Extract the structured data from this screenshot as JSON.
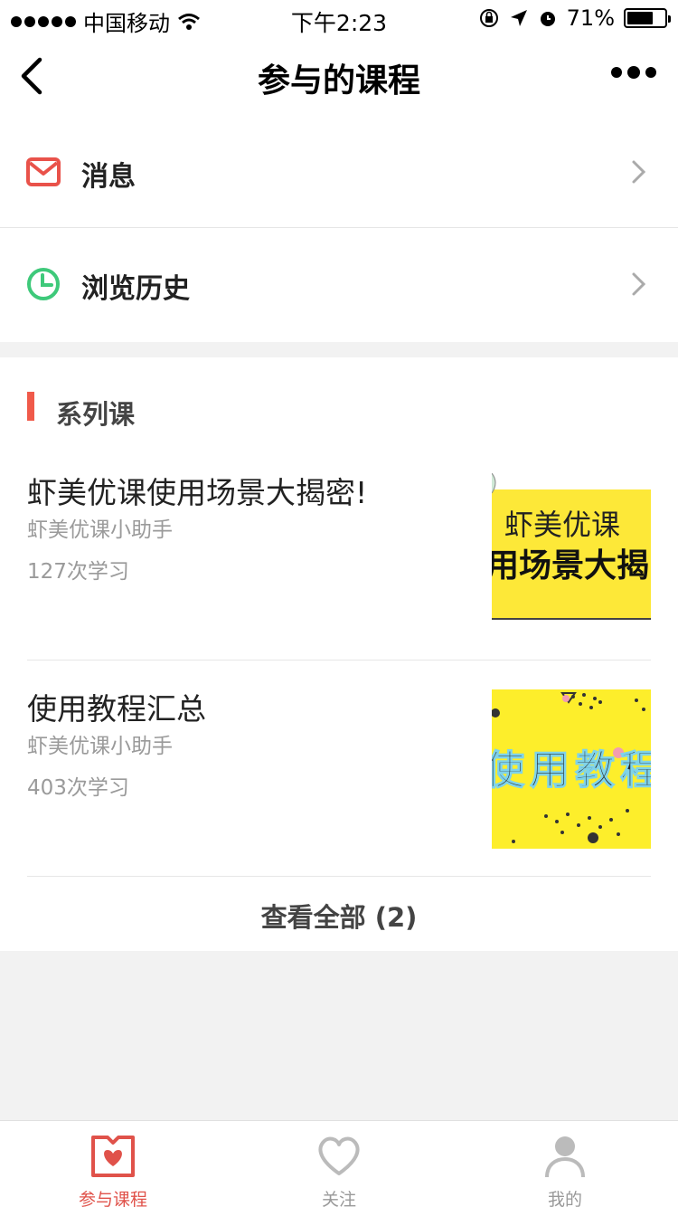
{
  "status_bar": {
    "carrier": "中国移动",
    "time": "下午2:23",
    "battery": "71%",
    "battery_level": 0.71
  },
  "nav": {
    "title": "参与的课程",
    "back_icon": "chevron-left-icon",
    "more_icon": "more-dots-icon"
  },
  "menu": {
    "items": [
      {
        "label": "消息",
        "icon": "mail-icon",
        "color": "#e9524a"
      },
      {
        "label": "浏览历史",
        "icon": "clock-icon",
        "color": "#3ec97a"
      }
    ]
  },
  "series": {
    "title": "系列课",
    "accent": "#f05a4a",
    "courses": [
      {
        "title": "虾美优课使用场景大揭密!",
        "author": "虾美优课小助手",
        "count": "127次学习",
        "thumb_line1": "虾美优课",
        "thumb_line2": "用场景大揭"
      },
      {
        "title": "使用教程汇总",
        "author": "虾美优课小助手",
        "count": "403次学习",
        "thumb_line1": "使用教程"
      }
    ],
    "view_all": "查看全部 (2)"
  },
  "tabbar": {
    "tabs": [
      {
        "label": "参与课程",
        "icon": "course-heart-icon",
        "active": true
      },
      {
        "label": "关注",
        "icon": "heart-outline-icon",
        "active": false
      },
      {
        "label": "我的",
        "icon": "user-icon",
        "active": false
      }
    ],
    "active_color": "#e0524a"
  }
}
